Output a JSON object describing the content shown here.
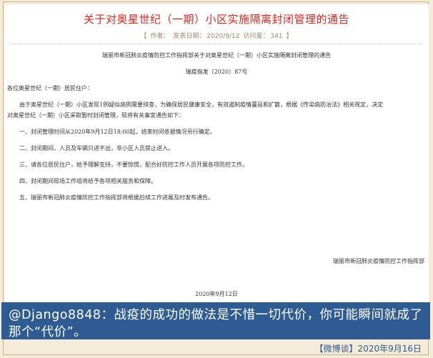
{
  "article": {
    "title": "关于对奥星世纪（一期）小区实施隔离封闭管理的通告",
    "meta": {
      "open": "【",
      "author_label": "作者：",
      "date_label": "发表日期：",
      "date": "2020/9/12",
      "visits_label": "访问量：",
      "visits": "341",
      "close": "】"
    }
  },
  "notice": {
    "heading": "瑞丽市新冠肺炎疫情防控工作指挥部关于对奥星世纪（一期）小区实施隔离封闭管理的通告",
    "doc_number": "瑞疫指发〔2020〕87号",
    "salutation": "各位奥星世纪（一期）居民住户：",
    "intro_line1": "由于奥星世纪（一期）小区发现1例疑似病例需要排查，为确保居民健康安全，有效遏制疫情蔓延和扩散，根据《传染病防治法》相关规定，决定",
    "intro_line2": "对奥星世纪（一期）小区采取暂时封闭管理，现将有关事宜通告如下：",
    "items": [
      "一、封闭管理时间从2020年9月12日18:00起，结束时间依据情况另行确定。",
      "二、封闭期间，人员及车辆只进不出，非小区人员禁止进入。",
      "三、请各位居民住户，给予理解支持，不要惊慌，配合好防控工作人员开展各项防控工作。",
      "四、封闭期间现场工作组将给予各项相关服务和保障。",
      "五、瑞丽市新冠肺炎疫情防控工作指挥部将根据后续工作进展及时发布通告。"
    ],
    "signature": "瑞丽市新冠肺炎疫情防控工作指挥部",
    "date": "2020年9月12日"
  },
  "comment": {
    "text": "@Django8848：战疫的成功的做法是不惜一切代价，你可能瞬间就成了那个“代价”。"
  },
  "footer": {
    "source": "【微博谈】2020年9月16日"
  },
  "colors": {
    "title_red": "#d9241b",
    "band_blue": "#2f5b93",
    "background": "#f4ecd9"
  }
}
